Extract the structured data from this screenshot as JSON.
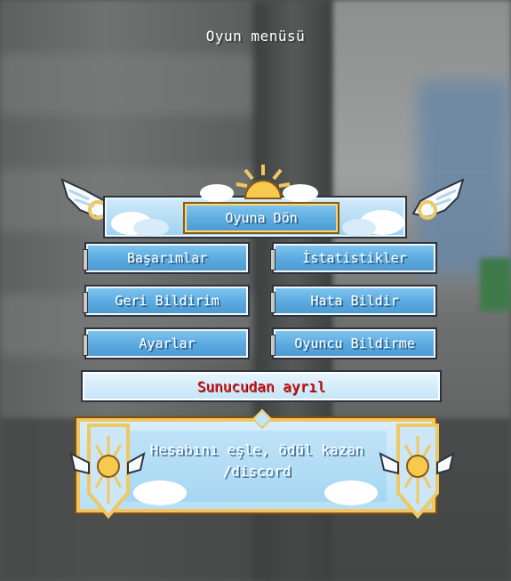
{
  "screen_title": "Oyun menüsü",
  "buttons": {
    "resume": "Oyuna Dön",
    "achievements": "Başarımlar",
    "statistics": "İstatistikler",
    "feedback": "Geri Bildirim",
    "report_bug": "Hata Bildir",
    "settings": "Ayarlar",
    "report_player": "Oyuncu Bildirme",
    "disconnect": "Sunucudan ayrıl"
  },
  "discord_panel": {
    "line1": "Hesabını eşle, ödül kazan",
    "line2": "/discord"
  },
  "colors": {
    "button_blue": "#5aa9e0",
    "gold_trim": "#f2c560",
    "disconnect_text": "#e01515"
  }
}
